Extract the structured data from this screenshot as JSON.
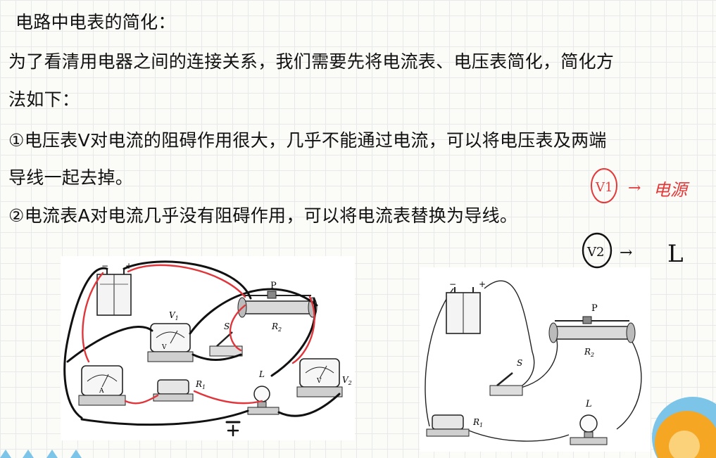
{
  "document": {
    "heading": "电路中电表的简化：",
    "intro_line1": "为了看清用电器之间的连接关系，我们需要先将电流表、电压表简化，简化方",
    "intro_line2": "法如下：",
    "rule1_line1": "①电压表V对电流的阻碍作用很大，几乎不能通过电流，可以将电压表及两端",
    "rule1_line2": "导线一起去掉。",
    "rule2": "②电流表A对电流几乎没有阻碍作用，可以将电流表替换为导线。"
  },
  "figure_left": {
    "label_p": "P",
    "label_v1": "V",
    "label_v1_sub": "1",
    "label_s": "S",
    "label_r2": "R",
    "label_r2_sub": "2",
    "label_r1": "R",
    "label_r1_sub": "1",
    "label_l": "L",
    "label_v2": "V",
    "label_v2_sub": "2",
    "label_a": "A",
    "label_minus": "−",
    "label_plus": "+"
  },
  "figure_right": {
    "label_minus": "−",
    "label_plus": "+",
    "label_p": "P",
    "label_s": "S",
    "label_r2": "R",
    "label_r2_sub": "2",
    "label_r1": "R",
    "label_r1_sub": "1",
    "label_l": "L"
  },
  "annotations": {
    "note1_symbol": "V1",
    "note1_arrow": "→",
    "note1_text": "电源",
    "note2_symbol": "V2",
    "note2_arrow": "→",
    "note2_text": "L"
  },
  "colors": {
    "ink": "#111111",
    "wire_red": "#e0353a",
    "annotation_red": "#e23a3a",
    "deco_orange": "#f5a623",
    "deco_blue": "#7cc4e8"
  }
}
